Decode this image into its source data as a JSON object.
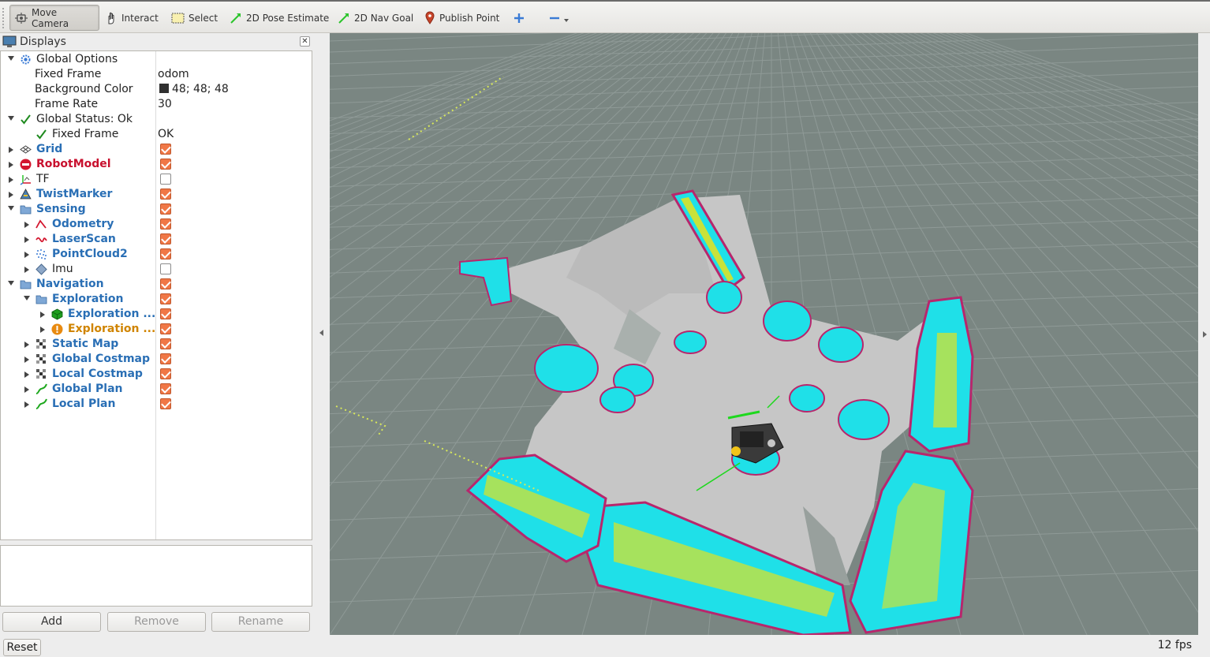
{
  "toolbar": {
    "tools": [
      {
        "label": "Move Camera",
        "icon": "move-camera-icon",
        "active": true
      },
      {
        "label": "Interact",
        "icon": "hand-icon"
      },
      {
        "label": "Select",
        "icon": "select-box-icon"
      },
      {
        "label": "2D Pose Estimate",
        "icon": "green-arrow-icon"
      },
      {
        "label": "2D Nav Goal",
        "icon": "green-arrow-icon"
      },
      {
        "label": "Publish Point",
        "icon": "map-pin-icon"
      }
    ]
  },
  "panel": {
    "title": "Displays",
    "tree": [
      {
        "label": "Global Options",
        "value": ""
      },
      {
        "label": "Fixed Frame",
        "value": "odom"
      },
      {
        "label": "Background Color",
        "value": "48; 48; 48"
      },
      {
        "label": "Frame Rate",
        "value": "30"
      },
      {
        "label": "Global Status: Ok",
        "value": ""
      },
      {
        "label": "Fixed Frame",
        "value": "OK"
      },
      {
        "label": "Grid",
        "checked": true
      },
      {
        "label": "RobotModel",
        "checked": true
      },
      {
        "label": "TF",
        "checked": false
      },
      {
        "label": "TwistMarker",
        "checked": true
      },
      {
        "label": "Sensing",
        "checked": true
      },
      {
        "label": "Odometry",
        "checked": true
      },
      {
        "label": "LaserScan",
        "checked": true
      },
      {
        "label": "PointCloud2",
        "checked": true
      },
      {
        "label": "Imu",
        "checked": false
      },
      {
        "label": "Navigation",
        "checked": true
      },
      {
        "label": "Exploration",
        "checked": true
      },
      {
        "label": "Exploration ...",
        "checked": true
      },
      {
        "label": "Exploration ...",
        "checked": true
      },
      {
        "label": "Static Map",
        "checked": true
      },
      {
        "label": "Global Costmap",
        "checked": true
      },
      {
        "label": "Local Costmap",
        "checked": true
      },
      {
        "label": "Global Plan",
        "checked": true
      },
      {
        "label": "Local Plan",
        "checked": true
      }
    ],
    "buttons": {
      "add": "Add",
      "remove": "Remove",
      "rename": "Rename"
    }
  },
  "status": {
    "reset": "Reset",
    "fps": "12 fps"
  },
  "colors": {
    "viewport_bg": "#7a8682",
    "map_free": "#c8c8c8",
    "costmap_cyan": "#1fe0e8",
    "costmap_yellow": "#c8e23a",
    "costmap_edge": "#b8266c",
    "checkbox": "#f07746",
    "link_blue": "#2a6fb5"
  }
}
